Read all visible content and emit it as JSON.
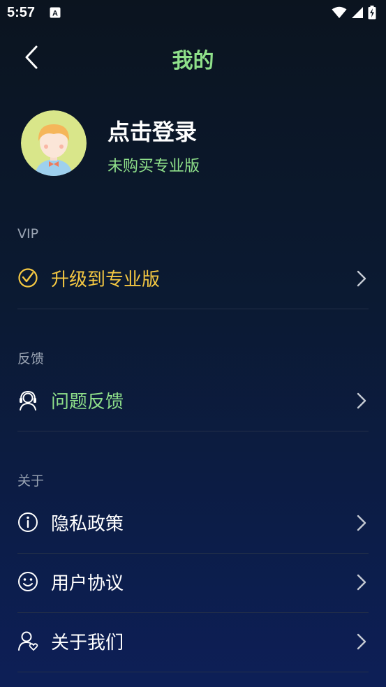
{
  "status_bar": {
    "time": "5:57",
    "icons": [
      "a-notification-icon",
      "wifi-icon",
      "signal-icon",
      "battery-charging-icon"
    ]
  },
  "header": {
    "title": "我的",
    "back_icon": "chevron-left-icon"
  },
  "profile": {
    "avatar": "cartoon-avatar",
    "name": "点击登录",
    "status": "未购买专业版"
  },
  "sections": {
    "vip": {
      "label": "VIP",
      "items": [
        {
          "label": "升级到专业版",
          "icon": "vip-check-icon",
          "color": "#f5c842"
        }
      ]
    },
    "feedback": {
      "label": "反馈",
      "items": [
        {
          "label": "问题反馈",
          "icon": "headset-support-icon",
          "color": "#8fe08a"
        }
      ]
    },
    "about": {
      "label": "关于",
      "items": [
        {
          "label": "隐私政策",
          "icon": "info-icon",
          "color": "#ffffff"
        },
        {
          "label": "用户协议",
          "icon": "smile-icon",
          "color": "#ffffff"
        },
        {
          "label": "关于我们",
          "icon": "user-heart-icon",
          "color": "#ffffff"
        }
      ]
    }
  },
  "colors": {
    "accent_green": "#8fe08a",
    "accent_yellow": "#f5c842",
    "section_label": "#9aa4b3",
    "divider": "#243049"
  }
}
